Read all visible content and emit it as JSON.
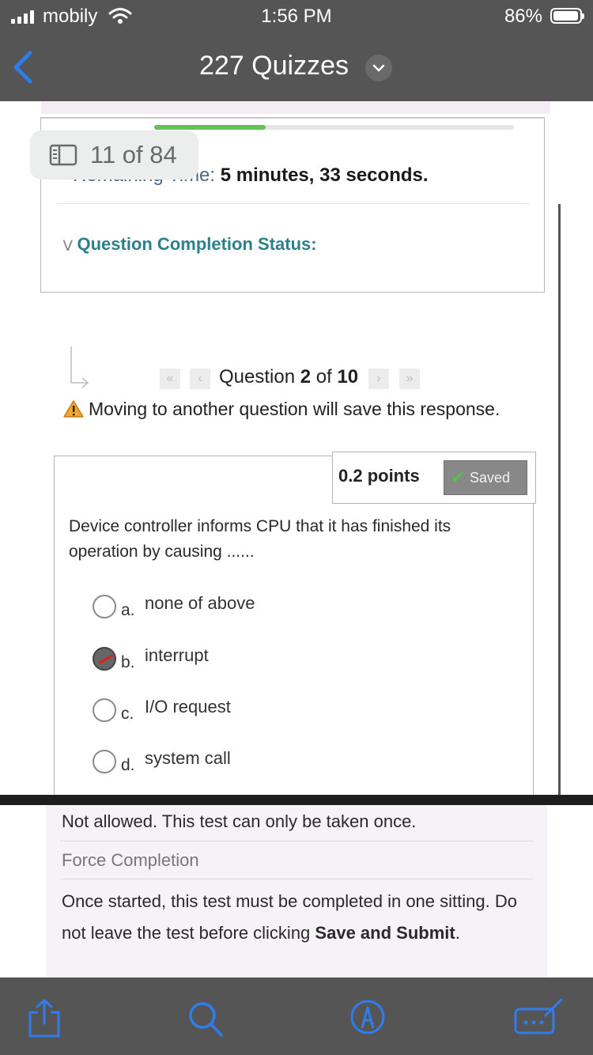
{
  "status_bar": {
    "carrier": "mobily",
    "time": "1:56 PM",
    "battery": "86%",
    "battery_level": 0.86
  },
  "nav": {
    "title": "227 Quizzes"
  },
  "page_indicator": "11 of 84",
  "test_status": {
    "remaining_label": "Remaining Time:",
    "remaining_value": "5 minutes, 33",
    "remaining_unit": "seconds.",
    "completion_label": "Question Completion Status:",
    "progress_fraction": 0.31
  },
  "question_nav": {
    "prefix": "Question",
    "current": "2",
    "of": "of",
    "total": "10",
    "warning": "Moving to another question will save this response."
  },
  "question": {
    "points": "0.2 points",
    "saved_label": "Saved",
    "text": "Device controller informs CPU that it has finished its operation by causing ......",
    "options": [
      {
        "letter": "a.",
        "text": "none of above",
        "selected": false
      },
      {
        "letter": "b.",
        "text": "interrupt",
        "selected": true
      },
      {
        "letter": "c.",
        "text": "I/O request",
        "selected": false
      },
      {
        "letter": "d.",
        "text": "system call",
        "selected": false
      }
    ]
  },
  "info": {
    "line1": "Not allowed. This test can only be taken once.",
    "line2": "Force Completion",
    "line3_prefix": "Once started, this test must be completed in one sitting. Do not leave the test before clicking",
    "line3_bold": "Save and Submit",
    "line3_suffix": "."
  },
  "toolbar": {
    "icons": [
      "share-icon",
      "search-icon",
      "markup-icon",
      "comment-icon"
    ]
  },
  "colors": {
    "bars": "#555555",
    "ios_blue": "#2f7dec",
    "completion_teal": "#2e7f8d",
    "progress_green": "#62c354"
  }
}
